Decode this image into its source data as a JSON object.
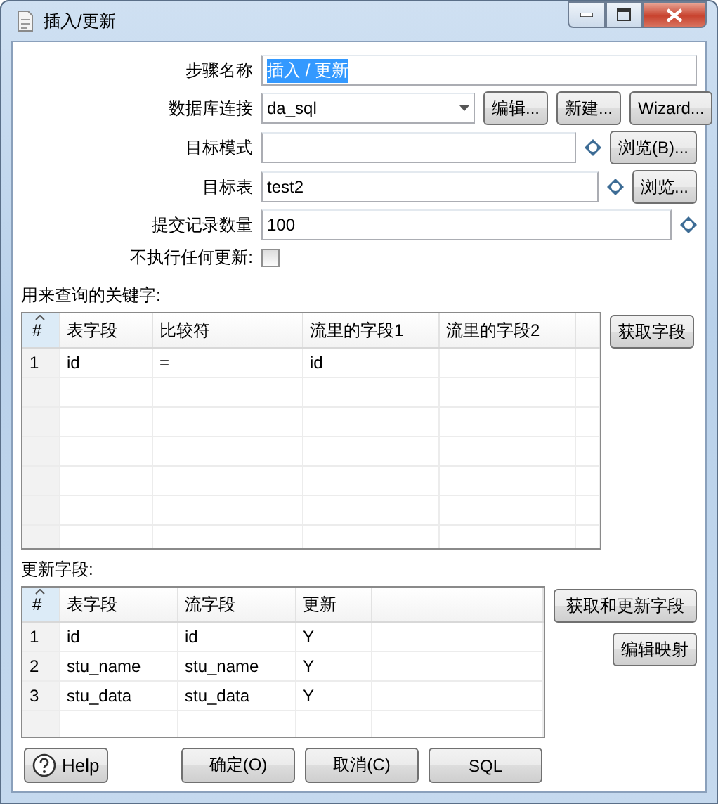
{
  "window": {
    "title": "插入/更新"
  },
  "fields": [
    {
      "kind": "text",
      "label": "步骤名称",
      "value": "插入 / 更新",
      "highlighted": true
    },
    {
      "kind": "combo",
      "label": "数据库连接",
      "value": "da_sql",
      "buttons": [
        "编辑...",
        "新建...",
        "Wizard..."
      ]
    },
    {
      "kind": "text",
      "label": "目标模式",
      "variable": true,
      "buttons": [
        "浏览(B)..."
      ]
    },
    {
      "kind": "text",
      "label": "目标表",
      "value": "test2",
      "variable": true,
      "buttons": [
        "浏览..."
      ]
    },
    {
      "kind": "text",
      "label": "提交记录数量",
      "value": "100",
      "variable": true
    },
    {
      "kind": "checkbox",
      "label": "不执行任何更新:",
      "checked": false
    }
  ],
  "key_table": {
    "label": "用来查询的关键字:",
    "columns": [
      "#",
      "表字段",
      "比较符",
      "流里的字段1",
      "流里的字段2"
    ],
    "rows": [
      [
        "1",
        "id",
        "=",
        "id"
      ]
    ],
    "buttons": [
      "获取字段"
    ]
  },
  "update_table": {
    "label": "更新字段:",
    "columns": [
      "#",
      "表字段",
      "流字段",
      "更新"
    ],
    "rows": [
      [
        "1",
        "id",
        "id",
        "Y"
      ],
      [
        "2",
        "stu_name",
        "stu_name",
        "Y"
      ],
      [
        "3",
        "stu_data",
        "stu_data",
        "Y"
      ]
    ],
    "buttons": [
      "获取和更新字段",
      "编辑映射"
    ]
  },
  "footer": [
    {
      "kind": "help",
      "label": "Help"
    },
    {
      "kind": "plain",
      "label": "确定(O)"
    },
    {
      "kind": "plain",
      "label": "取消(C)"
    },
    {
      "kind": "plain",
      "label": "SQL"
    }
  ]
}
